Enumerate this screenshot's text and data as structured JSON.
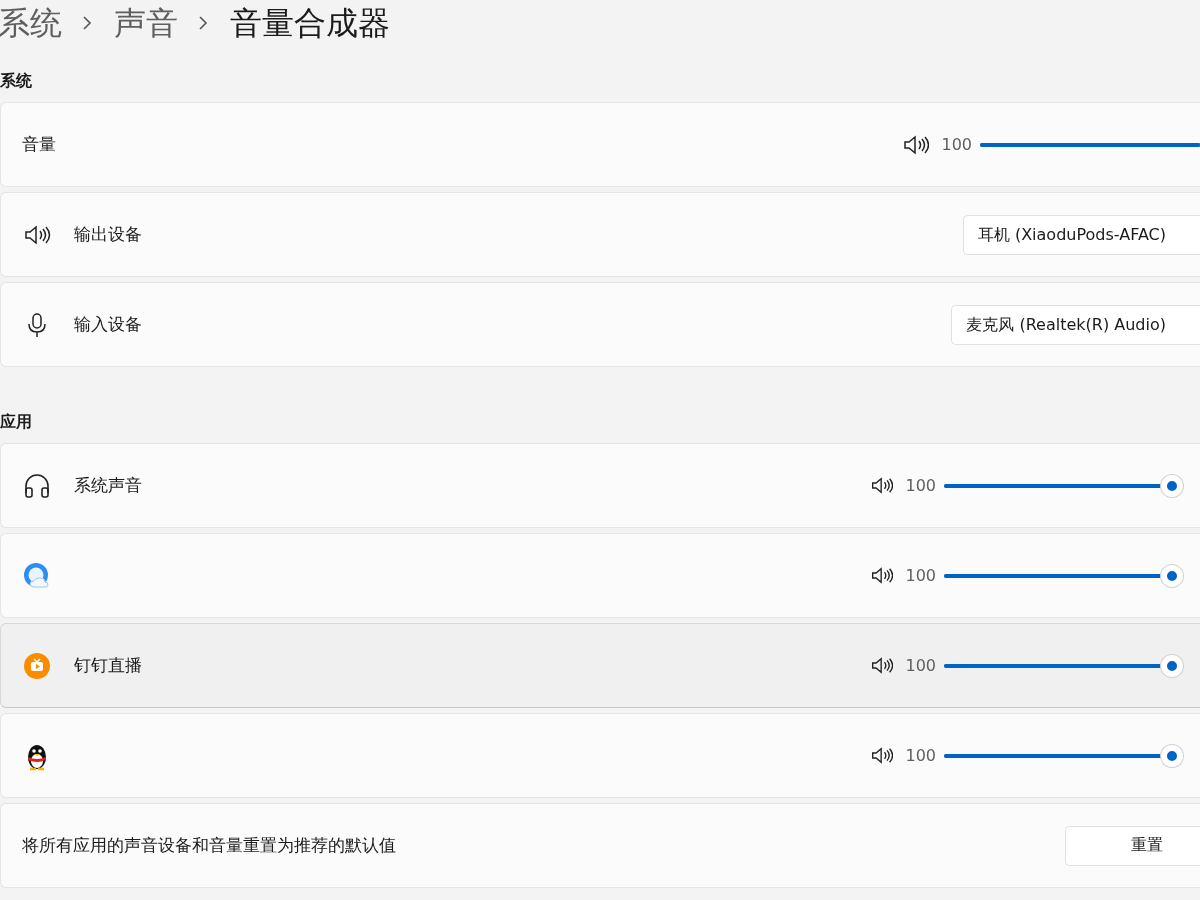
{
  "breadcrumb": [
    {
      "label": "系统",
      "current": false
    },
    {
      "label": "声音",
      "current": false
    },
    {
      "label": "音量合成器",
      "current": true
    }
  ],
  "system": {
    "heading": "系统",
    "volume": {
      "label": "音量",
      "reading": "100",
      "level": 1
    },
    "output_device": {
      "label": "输出设备",
      "value": "耳机 (XiaoduPods-AFAC)"
    },
    "input_device": {
      "label": "输入设备",
      "value": "麦克风 (Realtek(R) Audio)"
    }
  },
  "apps": {
    "heading": "应用",
    "items": [
      {
        "kind": "headphones",
        "name": "系统声音",
        "reading": "100",
        "level": 1,
        "highlighted": false
      },
      {
        "kind": "browser",
        "reading": "100",
        "level": 1,
        "highlighted": false
      },
      {
        "kind": "live",
        "name": "钉钉直播",
        "reading": "100",
        "level": 1,
        "highlighted": true
      },
      {
        "kind": "penguin",
        "reading": "100",
        "level": 1,
        "highlighted": false
      }
    ]
  },
  "reset": {
    "label": "将所有应用的声音设备和音量重置为推荐的默认值",
    "button": "重置"
  }
}
